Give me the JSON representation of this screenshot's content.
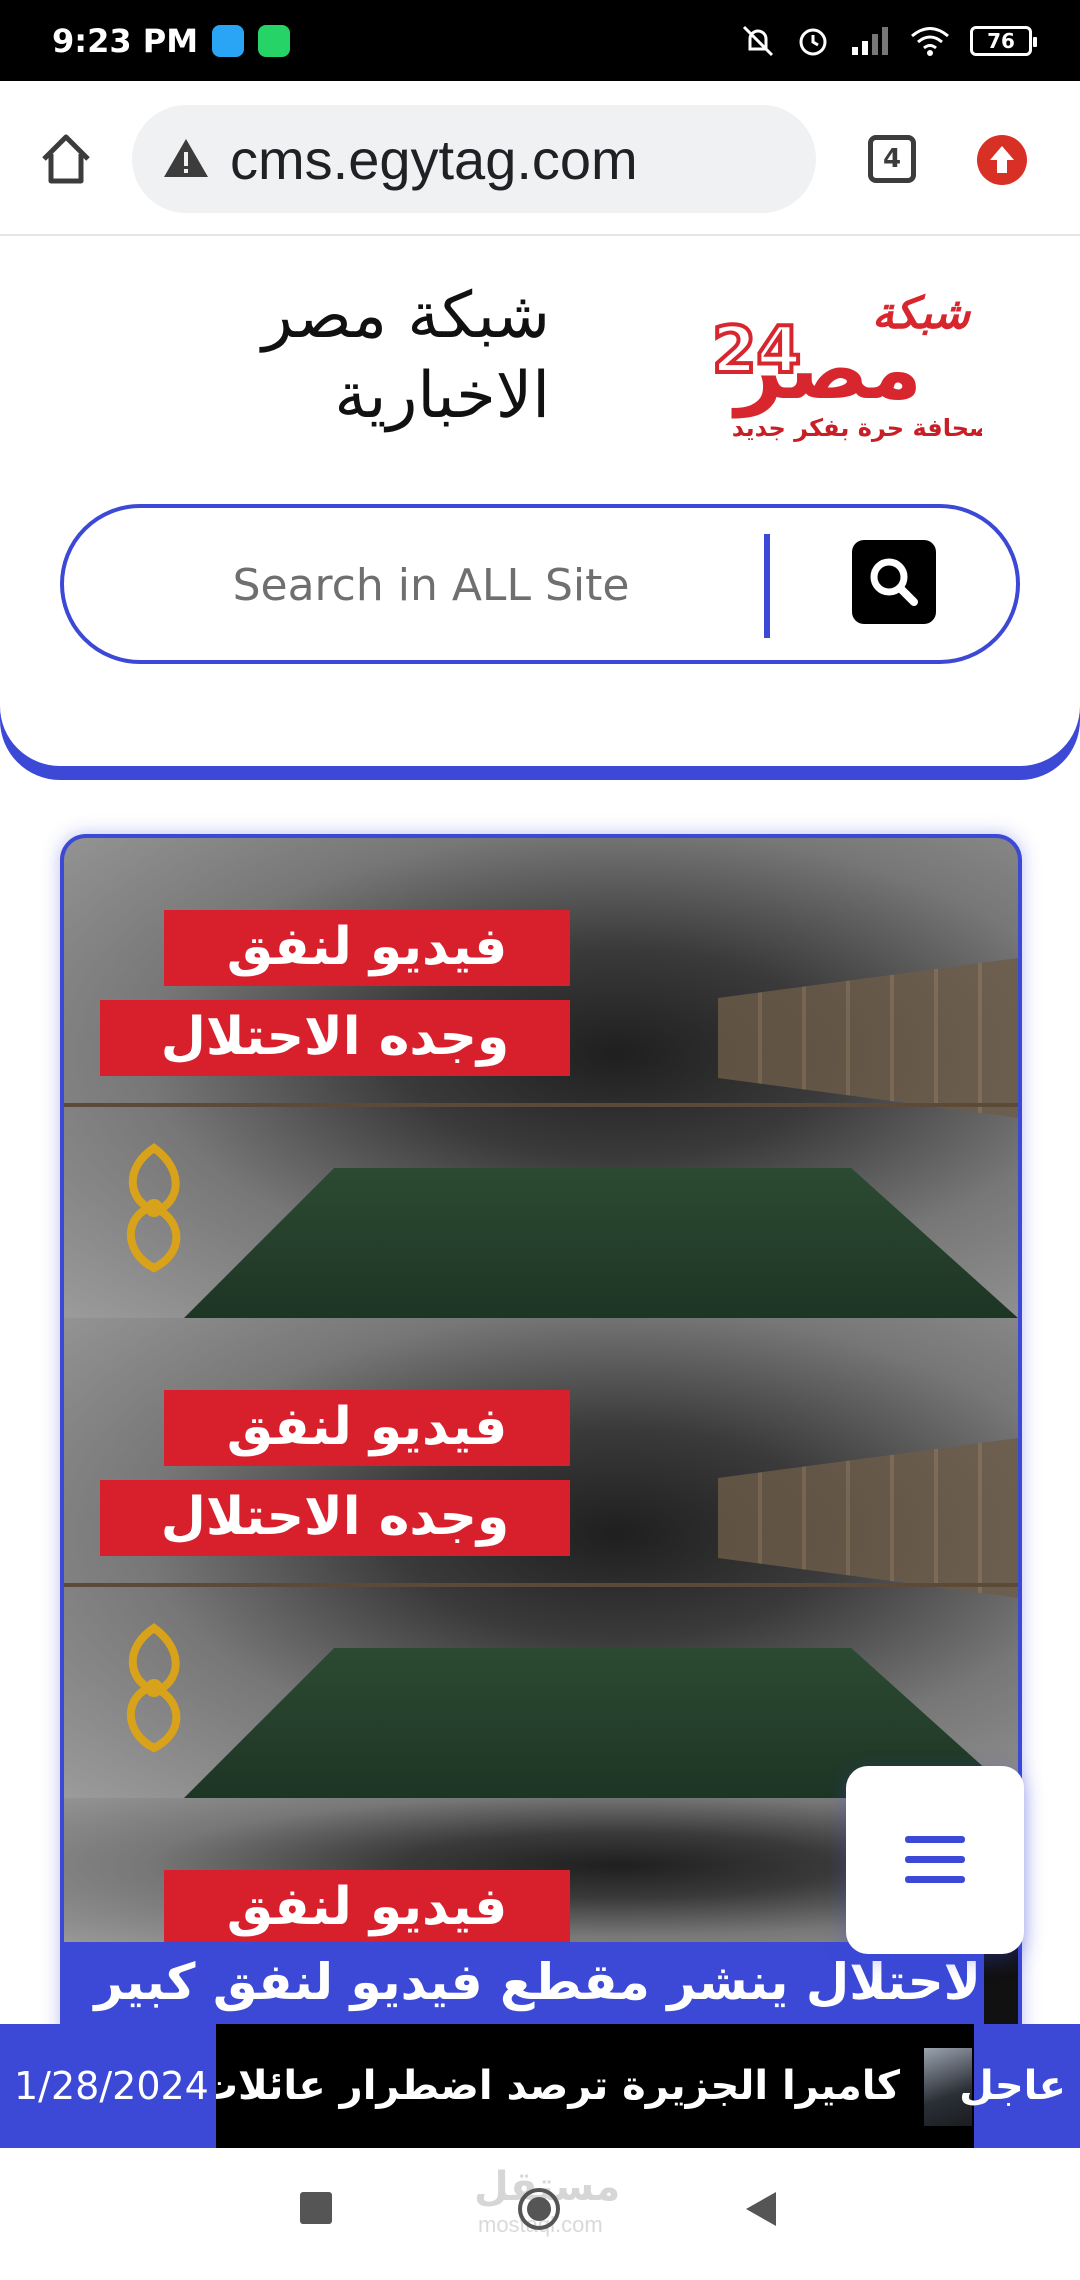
{
  "status_bar": {
    "time": "9:23 PM",
    "battery": "76"
  },
  "browser": {
    "url": "cms.egytag.com",
    "tab_count": "4"
  },
  "site": {
    "title_line1": "شبكة مصر",
    "title_line2": "الاخبارية",
    "logo_text": "شبكة مصر 24",
    "logo_tagline": "صحافة حرة بفكر جديد",
    "search_placeholder": "Search in ALL Site"
  },
  "article": {
    "image_caption_line1": "فيديو لنفق",
    "image_caption_line2": "وجده الاحتلال",
    "headline": "الاحتلال ينشر مقطع فيديو لنفق كبير"
  },
  "ticker": {
    "label": "عاجل",
    "text": "كاميرا الجزيرة ترصد اضطرار عائلات فلسطينية",
    "date": "1/28/2024"
  },
  "watermark": {
    "text": "مستقل",
    "sub": "mostaql.com"
  },
  "colors": {
    "accent": "#3b49d6",
    "tag_red": "#d8202d"
  }
}
